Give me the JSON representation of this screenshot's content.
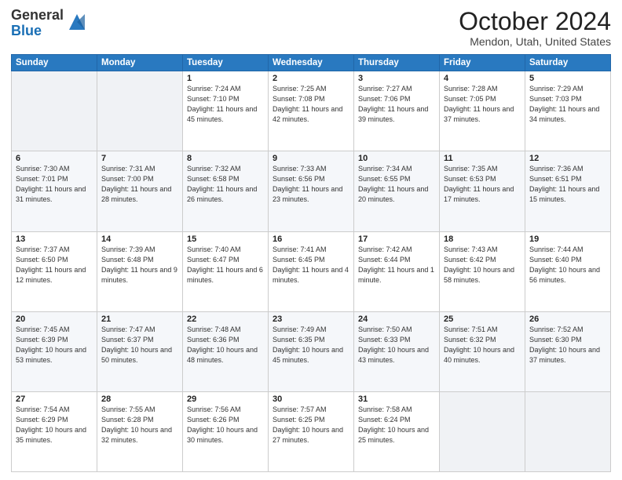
{
  "header": {
    "logo_general": "General",
    "logo_blue": "Blue",
    "month_title": "October 2024",
    "location": "Mendon, Utah, United States"
  },
  "days_of_week": [
    "Sunday",
    "Monday",
    "Tuesday",
    "Wednesday",
    "Thursday",
    "Friday",
    "Saturday"
  ],
  "weeks": [
    [
      {
        "day": "",
        "info": ""
      },
      {
        "day": "",
        "info": ""
      },
      {
        "day": "1",
        "info": "Sunrise: 7:24 AM\nSunset: 7:10 PM\nDaylight: 11 hours and 45 minutes."
      },
      {
        "day": "2",
        "info": "Sunrise: 7:25 AM\nSunset: 7:08 PM\nDaylight: 11 hours and 42 minutes."
      },
      {
        "day": "3",
        "info": "Sunrise: 7:27 AM\nSunset: 7:06 PM\nDaylight: 11 hours and 39 minutes."
      },
      {
        "day": "4",
        "info": "Sunrise: 7:28 AM\nSunset: 7:05 PM\nDaylight: 11 hours and 37 minutes."
      },
      {
        "day": "5",
        "info": "Sunrise: 7:29 AM\nSunset: 7:03 PM\nDaylight: 11 hours and 34 minutes."
      }
    ],
    [
      {
        "day": "6",
        "info": "Sunrise: 7:30 AM\nSunset: 7:01 PM\nDaylight: 11 hours and 31 minutes."
      },
      {
        "day": "7",
        "info": "Sunrise: 7:31 AM\nSunset: 7:00 PM\nDaylight: 11 hours and 28 minutes."
      },
      {
        "day": "8",
        "info": "Sunrise: 7:32 AM\nSunset: 6:58 PM\nDaylight: 11 hours and 26 minutes."
      },
      {
        "day": "9",
        "info": "Sunrise: 7:33 AM\nSunset: 6:56 PM\nDaylight: 11 hours and 23 minutes."
      },
      {
        "day": "10",
        "info": "Sunrise: 7:34 AM\nSunset: 6:55 PM\nDaylight: 11 hours and 20 minutes."
      },
      {
        "day": "11",
        "info": "Sunrise: 7:35 AM\nSunset: 6:53 PM\nDaylight: 11 hours and 17 minutes."
      },
      {
        "day": "12",
        "info": "Sunrise: 7:36 AM\nSunset: 6:51 PM\nDaylight: 11 hours and 15 minutes."
      }
    ],
    [
      {
        "day": "13",
        "info": "Sunrise: 7:37 AM\nSunset: 6:50 PM\nDaylight: 11 hours and 12 minutes."
      },
      {
        "day": "14",
        "info": "Sunrise: 7:39 AM\nSunset: 6:48 PM\nDaylight: 11 hours and 9 minutes."
      },
      {
        "day": "15",
        "info": "Sunrise: 7:40 AM\nSunset: 6:47 PM\nDaylight: 11 hours and 6 minutes."
      },
      {
        "day": "16",
        "info": "Sunrise: 7:41 AM\nSunset: 6:45 PM\nDaylight: 11 hours and 4 minutes."
      },
      {
        "day": "17",
        "info": "Sunrise: 7:42 AM\nSunset: 6:44 PM\nDaylight: 11 hours and 1 minute."
      },
      {
        "day": "18",
        "info": "Sunrise: 7:43 AM\nSunset: 6:42 PM\nDaylight: 10 hours and 58 minutes."
      },
      {
        "day": "19",
        "info": "Sunrise: 7:44 AM\nSunset: 6:40 PM\nDaylight: 10 hours and 56 minutes."
      }
    ],
    [
      {
        "day": "20",
        "info": "Sunrise: 7:45 AM\nSunset: 6:39 PM\nDaylight: 10 hours and 53 minutes."
      },
      {
        "day": "21",
        "info": "Sunrise: 7:47 AM\nSunset: 6:37 PM\nDaylight: 10 hours and 50 minutes."
      },
      {
        "day": "22",
        "info": "Sunrise: 7:48 AM\nSunset: 6:36 PM\nDaylight: 10 hours and 48 minutes."
      },
      {
        "day": "23",
        "info": "Sunrise: 7:49 AM\nSunset: 6:35 PM\nDaylight: 10 hours and 45 minutes."
      },
      {
        "day": "24",
        "info": "Sunrise: 7:50 AM\nSunset: 6:33 PM\nDaylight: 10 hours and 43 minutes."
      },
      {
        "day": "25",
        "info": "Sunrise: 7:51 AM\nSunset: 6:32 PM\nDaylight: 10 hours and 40 minutes."
      },
      {
        "day": "26",
        "info": "Sunrise: 7:52 AM\nSunset: 6:30 PM\nDaylight: 10 hours and 37 minutes."
      }
    ],
    [
      {
        "day": "27",
        "info": "Sunrise: 7:54 AM\nSunset: 6:29 PM\nDaylight: 10 hours and 35 minutes."
      },
      {
        "day": "28",
        "info": "Sunrise: 7:55 AM\nSunset: 6:28 PM\nDaylight: 10 hours and 32 minutes."
      },
      {
        "day": "29",
        "info": "Sunrise: 7:56 AM\nSunset: 6:26 PM\nDaylight: 10 hours and 30 minutes."
      },
      {
        "day": "30",
        "info": "Sunrise: 7:57 AM\nSunset: 6:25 PM\nDaylight: 10 hours and 27 minutes."
      },
      {
        "day": "31",
        "info": "Sunrise: 7:58 AM\nSunset: 6:24 PM\nDaylight: 10 hours and 25 minutes."
      },
      {
        "day": "",
        "info": ""
      },
      {
        "day": "",
        "info": ""
      }
    ]
  ]
}
